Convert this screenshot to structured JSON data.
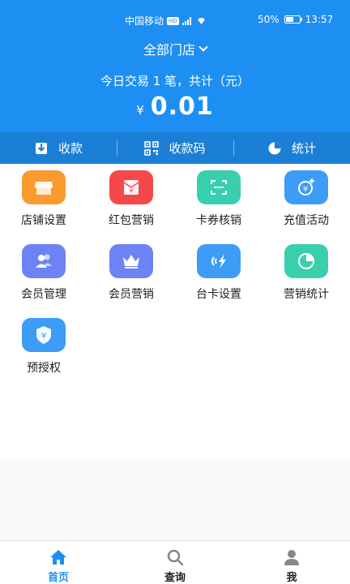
{
  "status_bar": {
    "carrier": "中国移动",
    "network_tag": "HD",
    "battery": "50%",
    "time": "13:57"
  },
  "header": {
    "store_selector": "全部门店",
    "summary": "今日交易 1 笔，共计（元）",
    "currency": "¥",
    "amount": "0.01"
  },
  "actions": [
    {
      "label": "收款",
      "icon": "download-icon"
    },
    {
      "label": "收款码",
      "icon": "qr-code-icon"
    },
    {
      "label": "统计",
      "icon": "pie-chart-icon"
    }
  ],
  "grid": [
    {
      "label": "店铺设置",
      "icon": "store-icon",
      "color": "#fb9a2f"
    },
    {
      "label": "红包营销",
      "icon": "red-packet-icon",
      "color": "#f3494a"
    },
    {
      "label": "卡券核销",
      "icon": "scan-icon",
      "color": "#39cfae"
    },
    {
      "label": "充值活动",
      "icon": "recharge-icon",
      "color": "#3d9cf6"
    },
    {
      "label": "会员管理",
      "icon": "members-icon",
      "color": "#6d83f5"
    },
    {
      "label": "会员营销",
      "icon": "crown-icon",
      "color": "#6d83f5"
    },
    {
      "label": "台卡设置",
      "icon": "nfc-icon",
      "color": "#3d9cf6"
    },
    {
      "label": "营销统计",
      "icon": "chart-icon",
      "color": "#39cfae"
    },
    {
      "label": "预授权",
      "icon": "shield-yen-icon",
      "color": "#3d9cf6"
    }
  ],
  "tabs": [
    {
      "label": "首页",
      "icon": "home-icon",
      "active": true
    },
    {
      "label": "查询",
      "icon": "search-icon",
      "active": false
    },
    {
      "label": "我",
      "icon": "user-icon",
      "active": false
    }
  ],
  "colors": {
    "primary": "#1e8ff2",
    "action_bar": "#1b7fd6"
  }
}
